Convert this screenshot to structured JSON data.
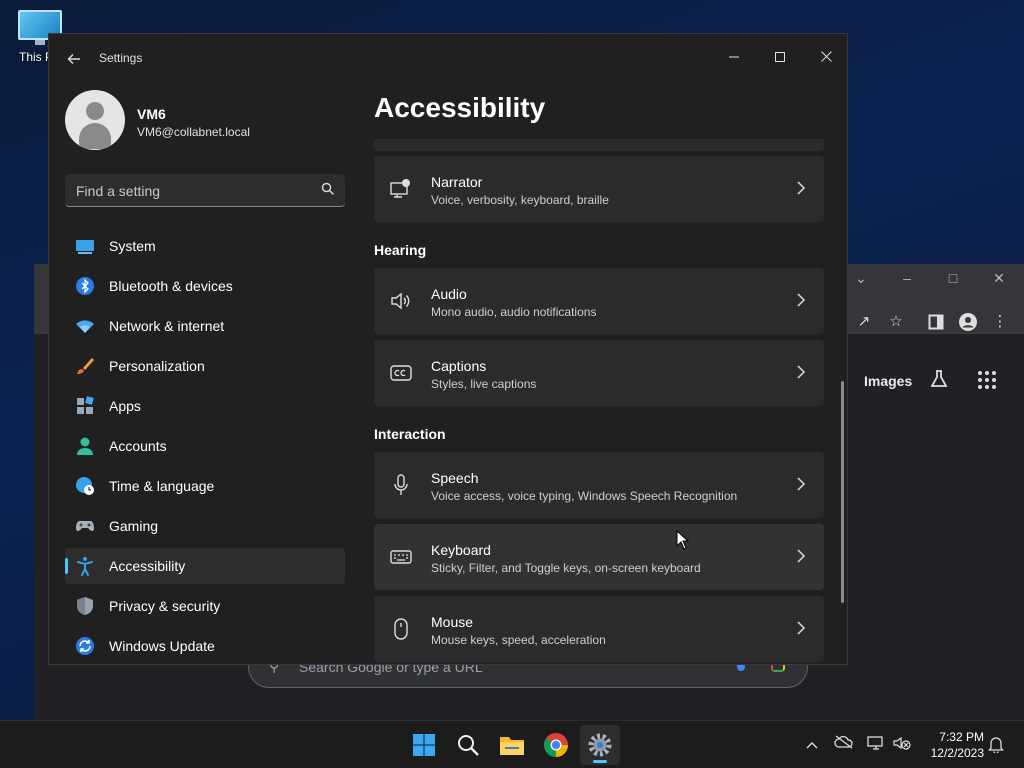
{
  "desktop": {
    "icon_label": "This PC"
  },
  "browser": {
    "images_label": "Images",
    "search_placeholder": "Search Google or type a URL"
  },
  "settings": {
    "app_title": "Settings",
    "user": {
      "name": "VM6",
      "email": "VM6@collabnet.local"
    },
    "search_placeholder": "Find a setting",
    "nav": [
      {
        "label": "System",
        "icon": "system-icon"
      },
      {
        "label": "Bluetooth & devices",
        "icon": "bluetooth-icon"
      },
      {
        "label": "Network & internet",
        "icon": "wifi-icon"
      },
      {
        "label": "Personalization",
        "icon": "brush-icon"
      },
      {
        "label": "Apps",
        "icon": "apps-icon"
      },
      {
        "label": "Accounts",
        "icon": "person-icon"
      },
      {
        "label": "Time & language",
        "icon": "globe-clock-icon"
      },
      {
        "label": "Gaming",
        "icon": "gamepad-icon"
      },
      {
        "label": "Accessibility",
        "icon": "accessibility-icon",
        "active": true
      },
      {
        "label": "Privacy & security",
        "icon": "shield-icon"
      },
      {
        "label": "Windows Update",
        "icon": "update-icon"
      }
    ],
    "page_title": "Accessibility",
    "sections": {
      "hearing": "Hearing",
      "interaction": "Interaction"
    },
    "cards": {
      "narrator": {
        "title": "Narrator",
        "subtitle": "Voice, verbosity, keyboard, braille"
      },
      "audio": {
        "title": "Audio",
        "subtitle": "Mono audio, audio notifications"
      },
      "captions": {
        "title": "Captions",
        "subtitle": "Styles, live captions"
      },
      "speech": {
        "title": "Speech",
        "subtitle": "Voice access, voice typing, Windows Speech Recognition"
      },
      "keyboard": {
        "title": "Keyboard",
        "subtitle": "Sticky, Filter, and Toggle keys, on-screen keyboard"
      },
      "mouse": {
        "title": "Mouse",
        "subtitle": "Mouse keys, speed, acceleration"
      }
    }
  },
  "taskbar": {
    "time": "7:32 PM",
    "date": "12/2/2023"
  },
  "colors": {
    "accent": "#4cc2ff",
    "window_bg": "#202020",
    "card_bg": "#2b2b2b"
  }
}
